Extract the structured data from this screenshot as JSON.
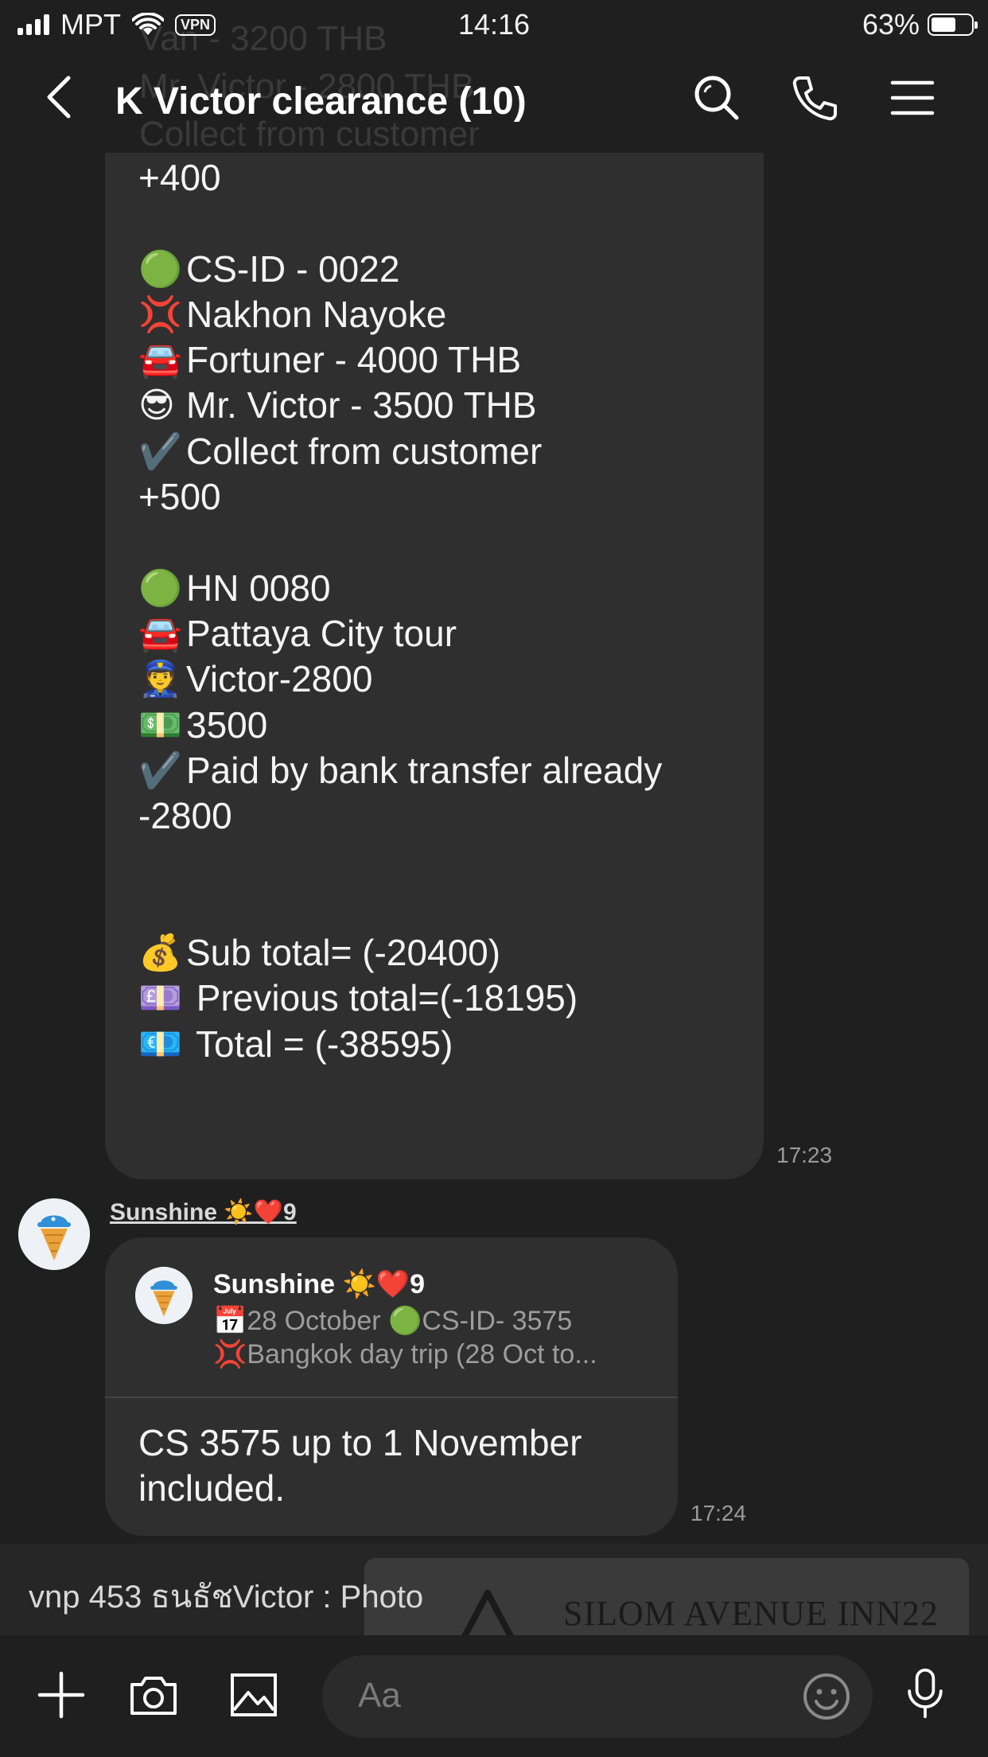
{
  "status_bar": {
    "carrier": "MPT",
    "vpn": "VPN",
    "time": "14:16",
    "battery": "63%",
    "battery_level": 0.63
  },
  "header": {
    "title": "K Victor clearance  (10)",
    "ghost_lines": [
      "Van  -  3200 THB",
      "Mr. Victor - 2800 THB",
      "Collect from customer"
    ]
  },
  "message_1": {
    "lines": [
      {
        "icon": "",
        "text": "+400"
      },
      {
        "icon": "",
        "text": ""
      },
      {
        "icon": "🟢",
        "text": "CS-ID - 0022"
      },
      {
        "icon": "💢",
        "text": "Nakhon Nayoke"
      },
      {
        "icon": "🚘",
        "text": "Fortuner - 4000 THB"
      },
      {
        "icon": "😎",
        "text": "Mr. Victor - 3500 THB"
      },
      {
        "icon": "✔️",
        "text": "Collect from customer"
      },
      {
        "icon": "",
        "text": "+500"
      },
      {
        "icon": "",
        "text": ""
      },
      {
        "icon": "🟢",
        "text": "HN 0080"
      },
      {
        "icon": "🚘",
        "text": "Pattaya City tour"
      },
      {
        "icon": "👮",
        "text": "Victor-2800"
      },
      {
        "icon": "💵",
        "text": "3500"
      },
      {
        "icon": "✔️",
        "text": "Paid by bank transfer already"
      },
      {
        "icon": "",
        "text": "-2800"
      },
      {
        "icon": "",
        "text": ""
      },
      {
        "icon": "",
        "text": ""
      },
      {
        "icon": "💰",
        "text": "Sub total= (-20400)"
      },
      {
        "icon": "💷",
        "text": " Previous total=(-18195)"
      },
      {
        "icon": "💶",
        "text": " Total = (-38595)"
      }
    ],
    "time": "17:23"
  },
  "message_2": {
    "sender": "Sunshine ☀️❤️9",
    "reply": {
      "name": "Sunshine ☀️❤️9",
      "line1_icon": "📅",
      "line1": "28 October 🟢CS-ID- 3575",
      "line2_icon": "💢",
      "line2": "Bangkok day trip (28 Oct to..."
    },
    "text": "CS 3575 up to 1 November included.",
    "time": "17:24"
  },
  "notification": {
    "text": "vnp 453 ธนธัชVictor : Photo",
    "photo_sign": "SILOM AVENUE INN22"
  },
  "input": {
    "placeholder": "Aa"
  },
  "colors": {
    "background": "#1f1f1f",
    "bubble": "#2f2f2f",
    "timestamp": "#9a9a9a"
  }
}
